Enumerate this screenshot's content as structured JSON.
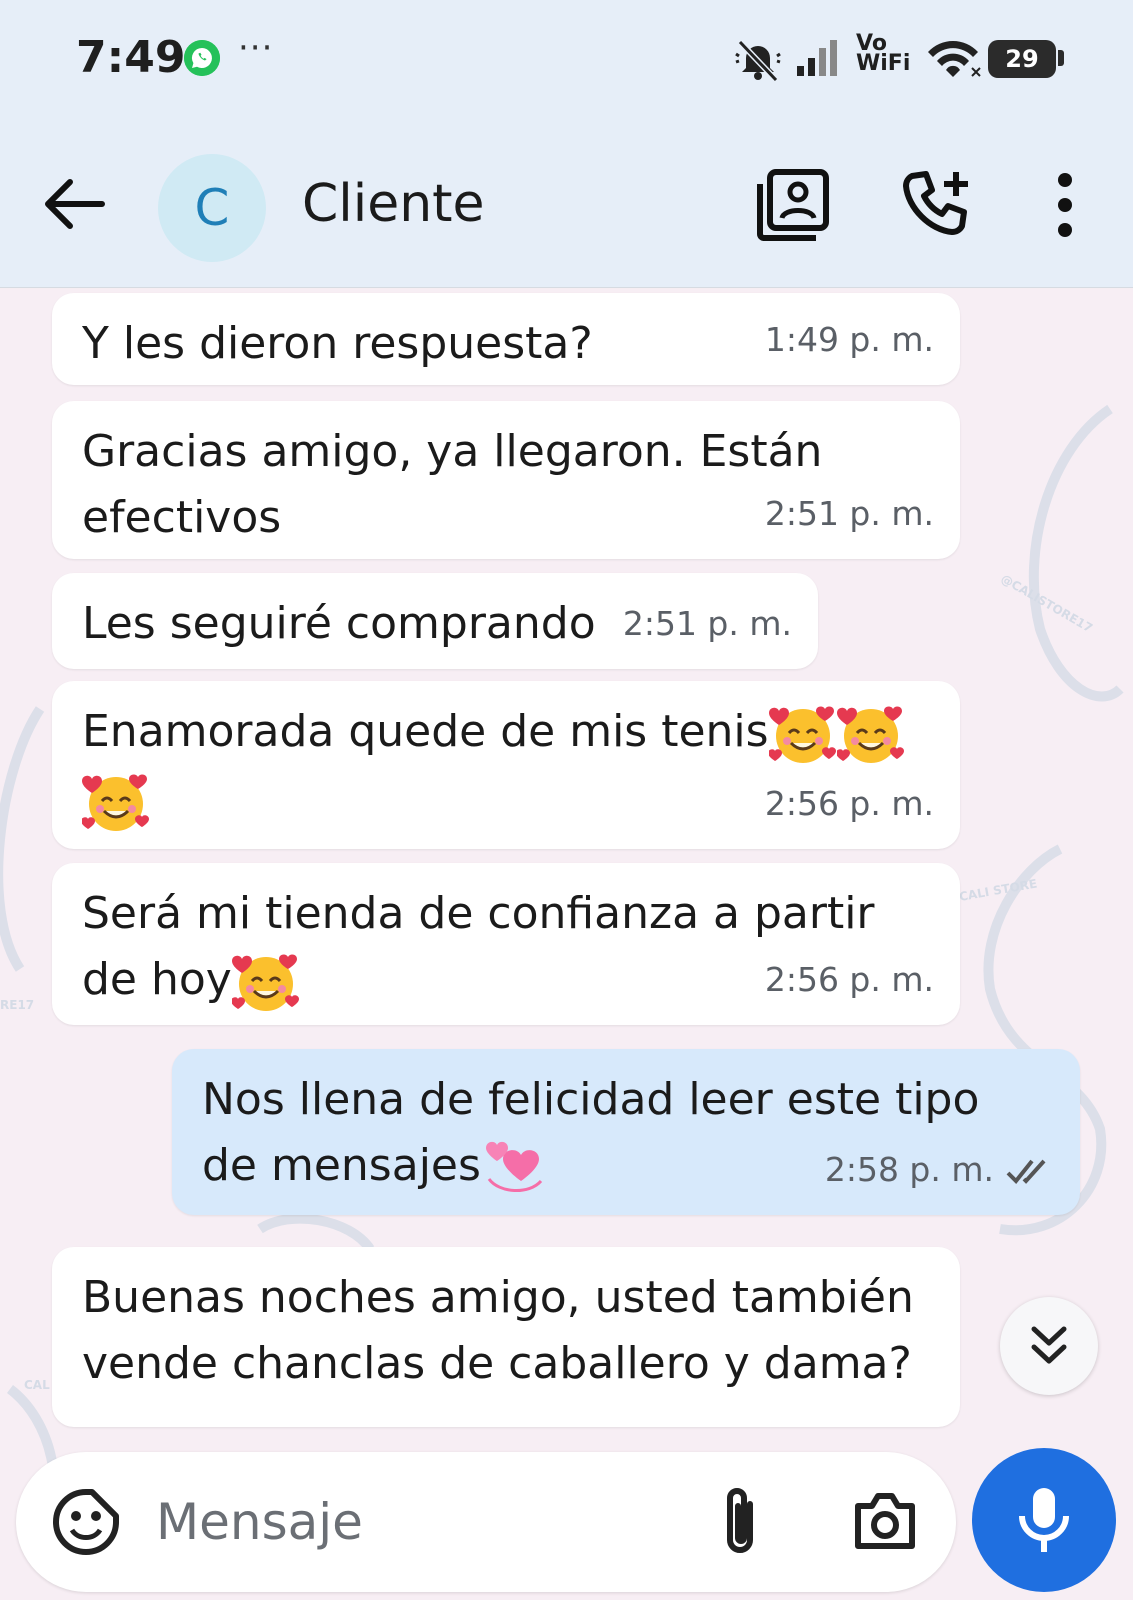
{
  "status_bar": {
    "time": "7:49",
    "more": "···",
    "vowifi_line1": "Vo",
    "vowifi_line2": "WiFi",
    "battery": "29",
    "icons": [
      "whatsapp-icon",
      "mute-icon",
      "signal-icon",
      "wifi-icon",
      "battery-icon"
    ]
  },
  "header": {
    "avatar_letter": "C",
    "contact_name": "Cliente",
    "icons": [
      "back-arrow-icon",
      "contact-card-icon",
      "add-call-icon",
      "more-vert-icon"
    ]
  },
  "messages": [
    {
      "direction": "incoming",
      "text": "Y les dieron respuesta?",
      "time": "1:49 p. m."
    },
    {
      "direction": "incoming",
      "line1": "Gracias amigo, ya llegaron. Están",
      "line2": "efectivos",
      "time": "2:51 p. m."
    },
    {
      "direction": "incoming",
      "text": "Les seguiré comprando",
      "time": "2:51 p. m."
    },
    {
      "direction": "incoming",
      "line1": "Enamorada quede de mis tenis",
      "emoji": "smiling-face-with-hearts",
      "emoji_count": 3,
      "time": "2:56 p. m."
    },
    {
      "direction": "incoming",
      "line1": "Será mi tienda de confianza a partir",
      "line2": "de hoy",
      "emoji": "smiling-face-with-hearts",
      "time": "2:56 p. m."
    },
    {
      "direction": "outgoing",
      "line1": "Nos llena de felicidad leer este tipo",
      "line2": "de mensajes",
      "emoji": "revolving-hearts",
      "time": "2:58 p. m.",
      "status": "read"
    },
    {
      "direction": "incoming",
      "line1": "Buenas noches amigo, usted también",
      "line2": "vende chanclas de caballero y dama?"
    }
  ],
  "input": {
    "placeholder": "Mensaje",
    "icons": [
      "sticker-icon",
      "paperclip-icon",
      "camera-icon",
      "mic-icon"
    ]
  },
  "colors": {
    "header_bg": "#e6eef8",
    "incoming_bubble": "#ffffff",
    "outgoing_bubble": "#d7e9fb",
    "mic_button": "#1f6fe0",
    "chat_bg": "#f7eef4"
  }
}
